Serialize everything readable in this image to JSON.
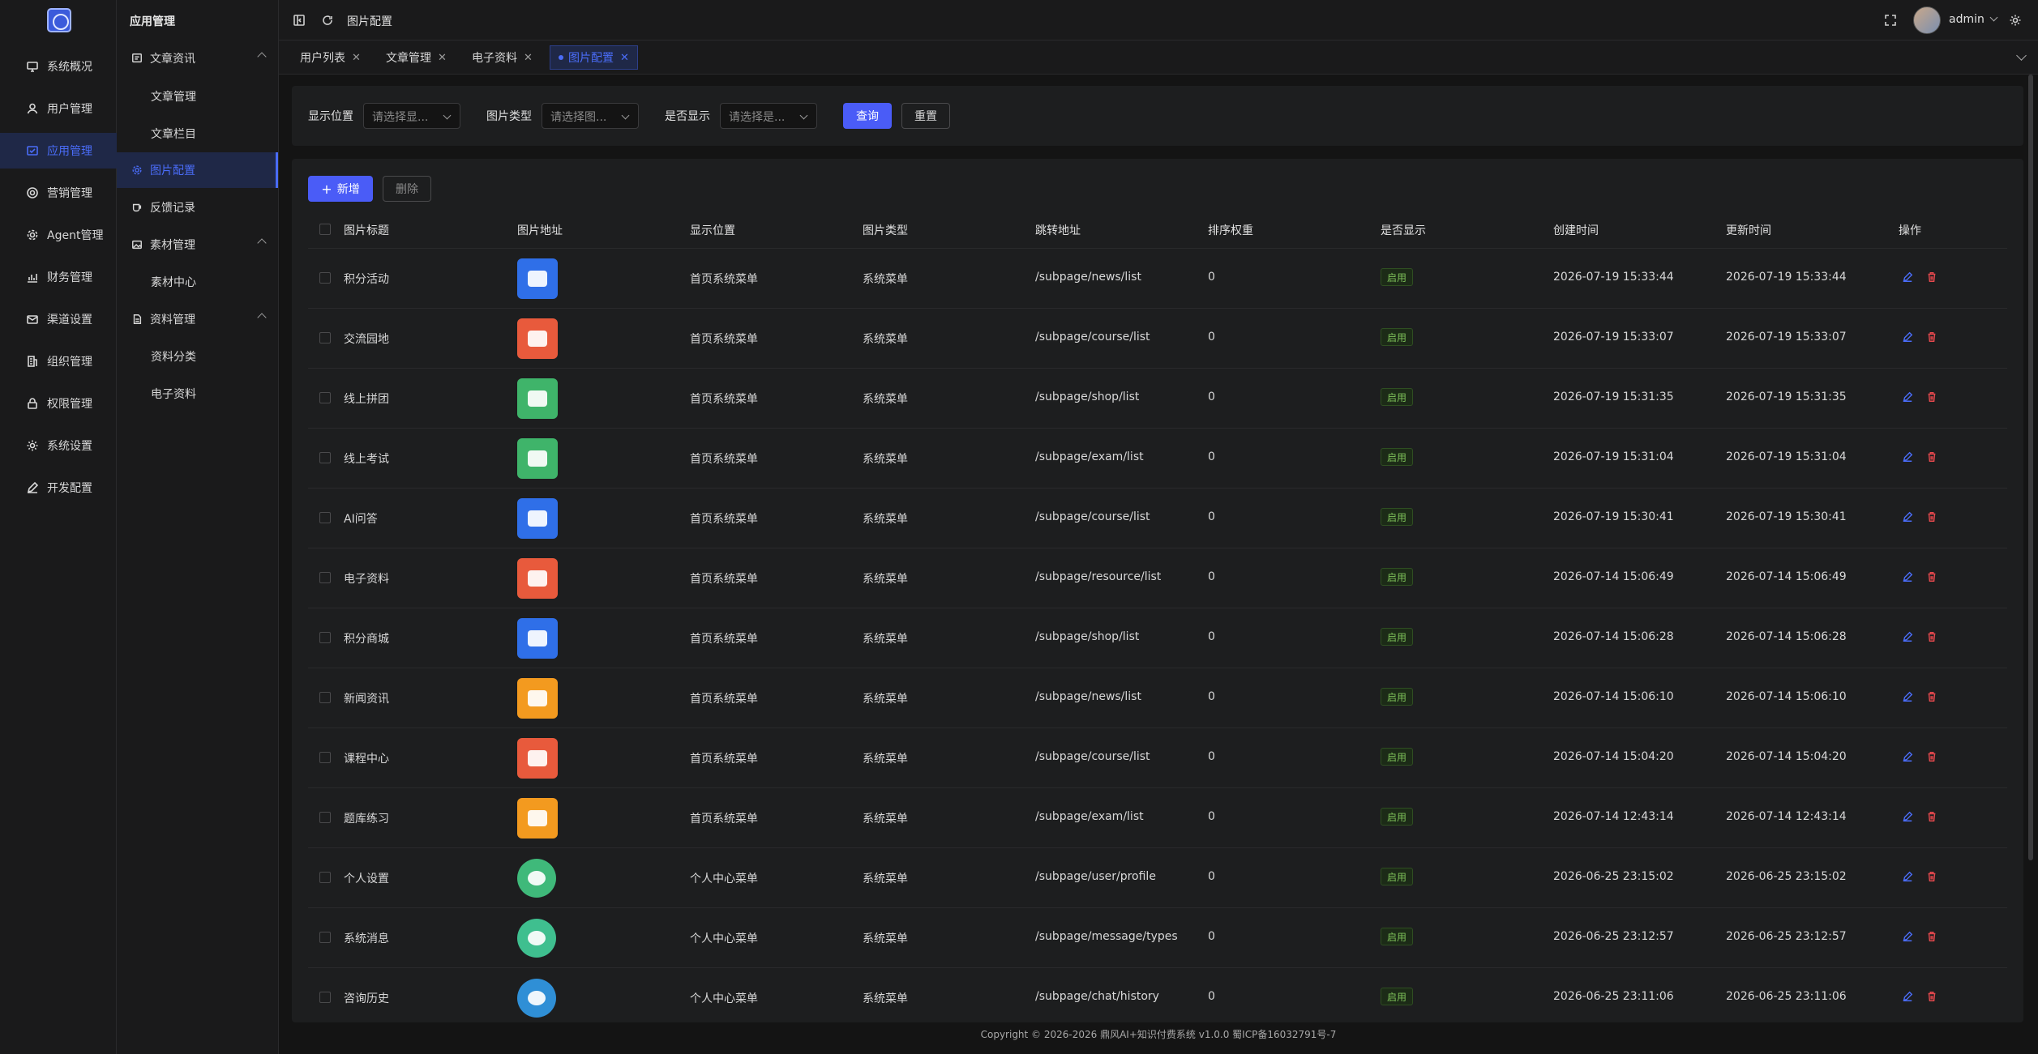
{
  "colors": {
    "accent": "#4a6cf7",
    "bg": "#141414",
    "panel": "#1d1e1f",
    "badge_green": "#7ec25a",
    "delete_red": "#e5484d"
  },
  "rail": {
    "items": [
      {
        "label": "系统概况",
        "icon": "monitor-icon"
      },
      {
        "label": "用户管理",
        "icon": "user-icon"
      },
      {
        "label": "应用管理",
        "icon": "app-icon"
      },
      {
        "label": "营销管理",
        "icon": "target-icon"
      },
      {
        "label": "Agent管理",
        "icon": "gear-icon"
      },
      {
        "label": "财务管理",
        "icon": "chart-icon"
      },
      {
        "label": "渠道设置",
        "icon": "mail-icon"
      },
      {
        "label": "组织管理",
        "icon": "building-icon"
      },
      {
        "label": "权限管理",
        "icon": "lock-icon"
      },
      {
        "label": "系统设置",
        "icon": "settings-icon"
      },
      {
        "label": "开发配置",
        "icon": "pen-icon"
      }
    ],
    "active_index": 2
  },
  "submenu": {
    "title": "应用管理",
    "group1": "文章资讯",
    "group1_items": [
      "文章管理",
      "文章栏目"
    ],
    "image_config": "图片配置",
    "feedback": "反馈记录",
    "group2": "素材管理",
    "group2_items": [
      "素材中心"
    ],
    "group3": "资料管理",
    "group3_items": [
      "资料分类",
      "电子资料"
    ]
  },
  "topbar": {
    "breadcrumb": "图片配置",
    "user": "admin"
  },
  "tabs": [
    "用户列表",
    "文章管理",
    "电子资料",
    "图片配置"
  ],
  "active_tab": 3,
  "search": {
    "position_label": "显示位置",
    "position_placeholder": "请选择显...",
    "type_label": "图片类型",
    "type_placeholder": "请选择图...",
    "show_label": "是否显示",
    "show_placeholder": "请选择是...",
    "query": "查询",
    "reset": "重置"
  },
  "toolbar": {
    "add": "新增",
    "delete": "删除"
  },
  "columns": [
    "图片标题",
    "图片地址",
    "显示位置",
    "图片类型",
    "跳转地址",
    "排序权重",
    "是否显示",
    "创建时间",
    "更新时间",
    "操作"
  ],
  "rows": [
    {
      "title": "积分活动",
      "icon_color": "#2f6fe8",
      "icon": "points-icon",
      "shape": "square",
      "position": "首页系统菜单",
      "type": "系统菜单",
      "url": "/subpage/news/list",
      "weight": "0",
      "show": "启用",
      "created": "2026-07-19 15:33:44",
      "updated": "2026-07-19 15:33:44"
    },
    {
      "title": "交流园地",
      "icon_color": "#e85a3c",
      "icon": "chat-icon",
      "shape": "square",
      "position": "首页系统菜单",
      "type": "系统菜单",
      "url": "/subpage/course/list",
      "weight": "0",
      "show": "启用",
      "created": "2026-07-19 15:33:07",
      "updated": "2026-07-19 15:33:07"
    },
    {
      "title": "线上拼团",
      "icon_color": "#3fb46a",
      "icon": "card-icon",
      "shape": "square",
      "position": "首页系统菜单",
      "type": "系统菜单",
      "url": "/subpage/shop/list",
      "weight": "0",
      "show": "启用",
      "created": "2026-07-19 15:31:35",
      "updated": "2026-07-19 15:31:35"
    },
    {
      "title": "线上考试",
      "icon_color": "#3fb46a",
      "icon": "exam-icon",
      "shape": "square",
      "position": "首页系统菜单",
      "type": "系统菜单",
      "url": "/subpage/exam/list",
      "weight": "0",
      "show": "启用",
      "created": "2026-07-19 15:31:04",
      "updated": "2026-07-19 15:31:04"
    },
    {
      "title": "AI问答",
      "icon_color": "#2f6fe8",
      "icon": "ai-icon",
      "shape": "square",
      "position": "首页系统菜单",
      "type": "系统菜单",
      "url": "/subpage/course/list",
      "weight": "0",
      "show": "启用",
      "created": "2026-07-19 15:30:41",
      "updated": "2026-07-19 15:30:41"
    },
    {
      "title": "电子资料",
      "icon_color": "#e85a3c",
      "icon": "book-icon",
      "shape": "square",
      "position": "首页系统菜单",
      "type": "系统菜单",
      "url": "/subpage/resource/list",
      "weight": "0",
      "show": "启用",
      "created": "2026-07-14 15:06:49",
      "updated": "2026-07-14 15:06:49"
    },
    {
      "title": "积分商城",
      "icon_color": "#2f6fe8",
      "icon": "points-icon",
      "shape": "square",
      "position": "首页系统菜单",
      "type": "系统菜单",
      "url": "/subpage/shop/list",
      "weight": "0",
      "show": "启用",
      "created": "2026-07-14 15:06:28",
      "updated": "2026-07-14 15:06:28"
    },
    {
      "title": "新闻资讯",
      "icon_color": "#f39a1f",
      "icon": "document-icon",
      "shape": "square",
      "position": "首页系统菜单",
      "type": "系统菜单",
      "url": "/subpage/news/list",
      "weight": "0",
      "show": "启用",
      "created": "2026-07-14 15:06:10",
      "updated": "2026-07-14 15:06:10"
    },
    {
      "title": "课程中心",
      "icon_color": "#e85a3c",
      "icon": "document-icon",
      "shape": "square",
      "position": "首页系统菜单",
      "type": "系统菜单",
      "url": "/subpage/course/list",
      "weight": "0",
      "show": "启用",
      "created": "2026-07-14 15:04:20",
      "updated": "2026-07-14 15:04:20"
    },
    {
      "title": "题库练习",
      "icon_color": "#f39a1f",
      "icon": "question-icon",
      "shape": "square",
      "position": "首页系统菜单",
      "type": "系统菜单",
      "url": "/subpage/exam/list",
      "weight": "0",
      "show": "启用",
      "created": "2026-07-14 12:43:14",
      "updated": "2026-07-14 12:43:14"
    },
    {
      "title": "个人设置",
      "icon_color": "#3fb97a",
      "icon": "settings-icon",
      "shape": "round",
      "position": "个人中心菜单",
      "type": "系统菜单",
      "url": "/subpage/user/profile",
      "weight": "0",
      "show": "启用",
      "created": "2026-06-25 23:15:02",
      "updated": "2026-06-25 23:15:02"
    },
    {
      "title": "系统消息",
      "icon_color": "#3fbf8f",
      "icon": "message-icon",
      "shape": "round",
      "position": "个人中心菜单",
      "type": "系统菜单",
      "url": "/subpage/message/types",
      "weight": "0",
      "show": "启用",
      "created": "2026-06-25 23:12:57",
      "updated": "2026-06-25 23:12:57"
    },
    {
      "title": "咨询历史",
      "icon_color": "#2f8fd6",
      "icon": "history-icon",
      "shape": "round",
      "position": "个人中心菜单",
      "type": "系统菜单",
      "url": "/subpage/chat/history",
      "weight": "0",
      "show": "启用",
      "created": "2026-06-25 23:11:06",
      "updated": "2026-06-25 23:11:06"
    }
  ],
  "footer": "Copyright © 2026-2026 鼎风AI+知识付费系统 v1.0.0   蜀ICP备16032791号-7"
}
